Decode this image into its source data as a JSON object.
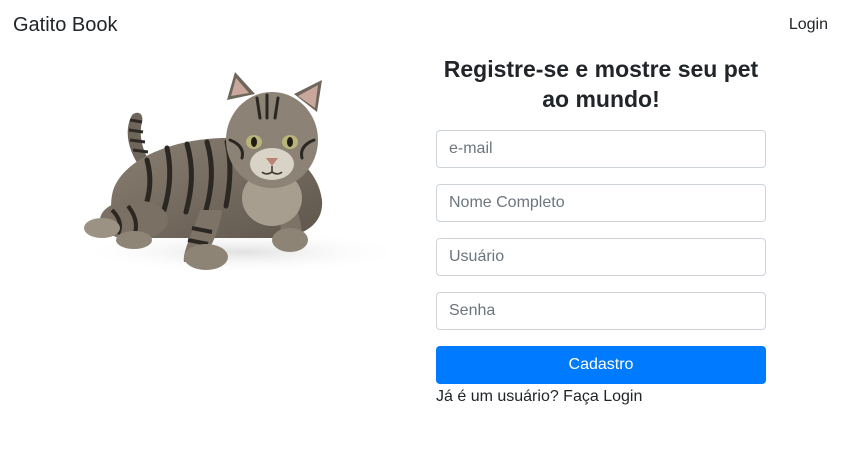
{
  "navbar": {
    "brand": "Gatito Book",
    "login_link": "Login"
  },
  "hero": {
    "image": "tabby-cat-lying-photo"
  },
  "form": {
    "title": "Registre-se e mostre seu pet ao mundo!",
    "fields": [
      {
        "placeholder": "e-mail",
        "value": ""
      },
      {
        "placeholder": "Nome Completo",
        "value": ""
      },
      {
        "placeholder": "Usuário",
        "value": ""
      },
      {
        "placeholder": "Senha",
        "value": ""
      }
    ],
    "submit_label": "Cadastro",
    "login_prompt": "Já é um usuário? Faça Login"
  },
  "colors": {
    "primary": "#007bff",
    "text": "#212529",
    "border": "#ced4da",
    "placeholder": "#6c757d"
  }
}
